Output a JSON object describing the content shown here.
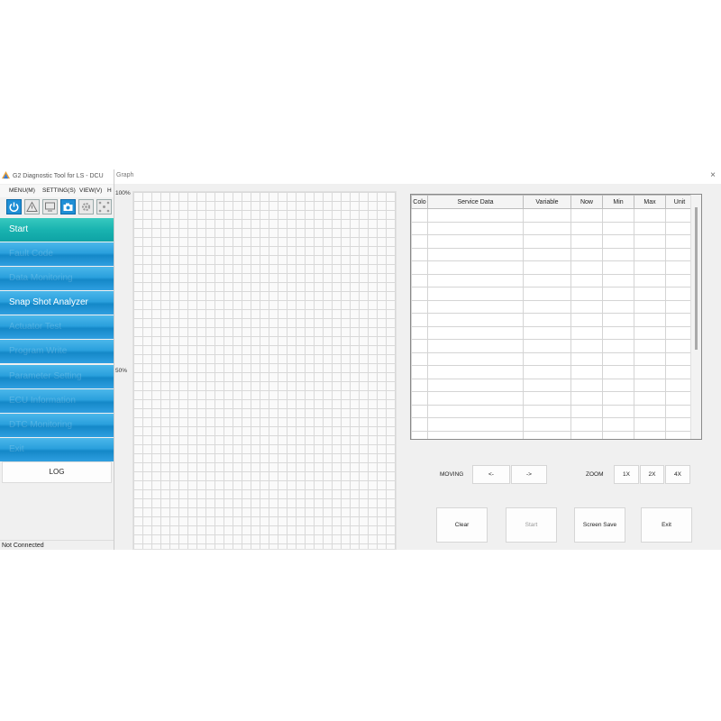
{
  "app": {
    "title": "G2 Diagnostic Tool for LS - DCU",
    "menu": [
      "MENU(M)",
      "SETTING(S)",
      "VIEW(V)",
      "H"
    ],
    "toolbar_icons": [
      "power-icon",
      "warning-icon",
      "monitor-icon",
      "camera-icon",
      "gear-icon",
      "network-icon"
    ],
    "sidebar": [
      {
        "label": "Start"
      },
      {
        "label": "Fault Code"
      },
      {
        "label": "Data Monitoring"
      },
      {
        "label": "Snap Shot Analyzer"
      },
      {
        "label": "Actuator Test"
      },
      {
        "label": "Program Write"
      },
      {
        "label": "Parameter Setting"
      },
      {
        "label": "ECU Information"
      },
      {
        "label": "DTC Monitoring"
      },
      {
        "label": "Exit"
      }
    ],
    "log_label": "LOG",
    "status": "Not Connected"
  },
  "graph": {
    "title": "Graph",
    "close": "×",
    "y_top": "100%",
    "y_mid": "50%",
    "columns": [
      "Colo",
      "Service Data",
      "Variable",
      "Now",
      "Min",
      "Max",
      "Unit"
    ],
    "row_count": 18,
    "moving_label": "MOVING",
    "move_left": "<-",
    "move_right": "->",
    "zoom_label": "ZOOM",
    "zoom_1x": "1X",
    "zoom_2x": "2X",
    "zoom_4x": "4X",
    "clear": "Clear",
    "start": "Start",
    "screen_save": "Screen Save",
    "exit": "Exit"
  }
}
